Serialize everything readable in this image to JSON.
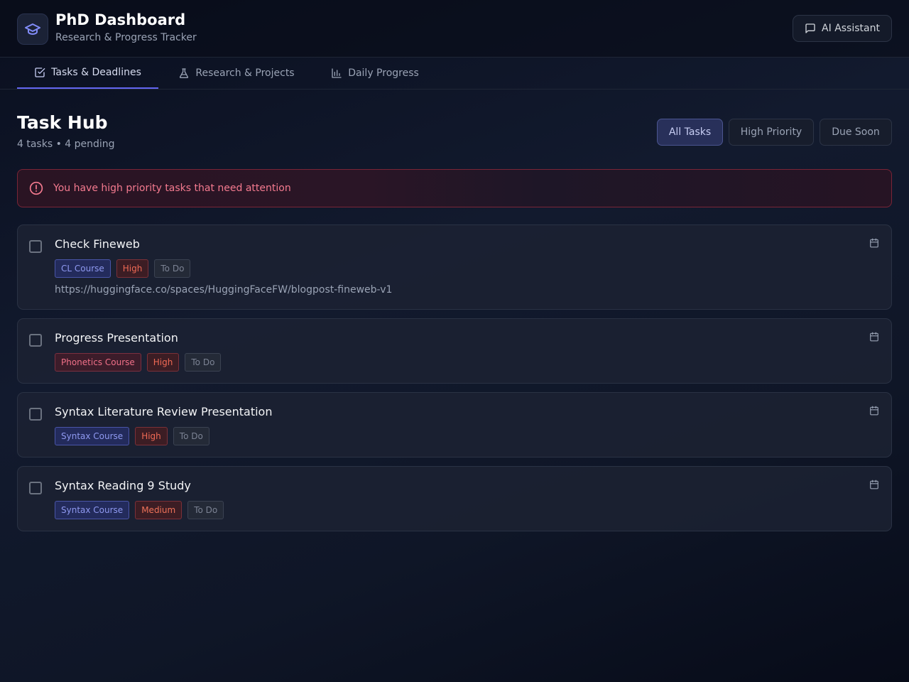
{
  "app": {
    "title": "PhD Dashboard",
    "subtitle": "Research & Progress Tracker",
    "ai_button": "AI Assistant"
  },
  "tabs": [
    {
      "label": "Tasks & Deadlines",
      "icon": "checkbox-icon",
      "active": true
    },
    {
      "label": "Research & Projects",
      "icon": "flask-icon",
      "active": false
    },
    {
      "label": "Daily Progress",
      "icon": "bar-chart-icon",
      "active": false
    }
  ],
  "section": {
    "title": "Task Hub",
    "summary": "4 tasks • 4 pending"
  },
  "filters": [
    {
      "label": "All Tasks",
      "active": true
    },
    {
      "label": "High Priority",
      "active": false
    },
    {
      "label": "Due Soon",
      "active": false
    }
  ],
  "alert": {
    "text": "You have high priority tasks that need attention",
    "icon": "alert-circle-icon"
  },
  "tasks": [
    {
      "title": "Check Fineweb",
      "course": "CL Course",
      "priority": "High",
      "status": "To Do",
      "link": "https://huggingface.co/spaces/HuggingFaceFW/blogpost-fineweb-v1"
    },
    {
      "title": "Progress Presentation",
      "course": "Phonetics Course",
      "priority": "High",
      "status": "To Do"
    },
    {
      "title": "Syntax Literature Review Presentation",
      "course": "Syntax Course",
      "priority": "High",
      "status": "To Do"
    },
    {
      "title": "Syntax Reading 9 Study",
      "course": "Syntax Course",
      "priority": "Medium",
      "status": "To Do"
    }
  ],
  "colors": {
    "accent": "#6366f1",
    "alert": "#f47a8f",
    "background": "#0f1627"
  }
}
